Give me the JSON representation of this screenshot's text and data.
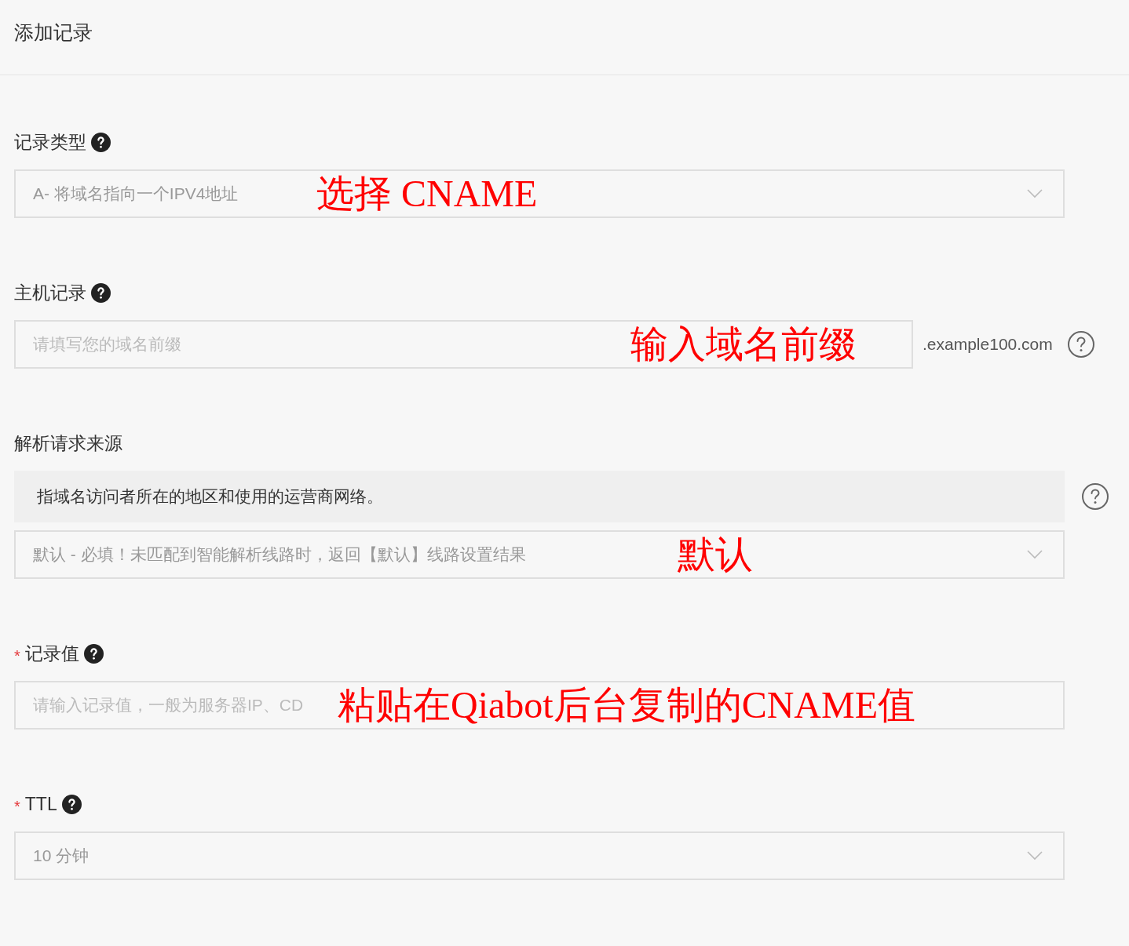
{
  "header": {
    "title": "添加记录"
  },
  "fields": [
    {
      "kind": "select",
      "label": "记录类型",
      "label_help": true,
      "side_help": false,
      "value": "A- 将域名指向一个IPV4地址",
      "annotation": "选择 CNAME"
    },
    {
      "kind": "input",
      "label": "主机记录",
      "label_help": true,
      "side_help": true,
      "placeholder": "请填写您的域名前缀",
      "suffix": ".example100.com",
      "annotation": "输入域名前缀"
    },
    {
      "kind": "select",
      "label": "解析请求来源",
      "label_help": false,
      "side_help": true,
      "note": "指域名访问者所在的地区和使用的运营商网络。",
      "value": "默认 - 必填！未匹配到智能解析线路时，返回【默认】线路设置结果",
      "annotation": "默认"
    },
    {
      "kind": "input",
      "required_mark": "*",
      "label": "记录值",
      "label_help": true,
      "side_help": false,
      "placeholder": "请输入记录值，一般为服务器IP、CD",
      "annotation": "粘贴在Qiabot后台复制的CNAME值"
    },
    {
      "kind": "select",
      "required_mark": "*",
      "label": "TTL",
      "label_help": true,
      "side_help": false,
      "value": "10 分钟"
    }
  ]
}
